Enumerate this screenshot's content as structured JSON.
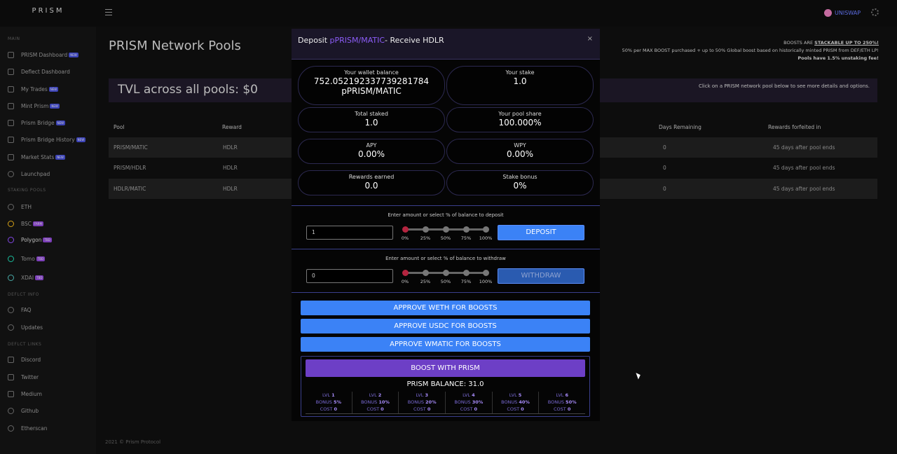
{
  "app": {
    "logo": "PRISM"
  },
  "header": {
    "wallet_label": "UNISWAP",
    "settings_icon": "gear-icon"
  },
  "sidebar": {
    "sections": {
      "main": "MAIN",
      "staking": "STAKING POOLS",
      "info": "DEFLCT INFO",
      "links": "DEFLCT LINKS"
    },
    "main_items": [
      {
        "label": "PRISM Dashboard",
        "badge": "NEW"
      },
      {
        "label": "Deflect Dashboard",
        "badge": ""
      },
      {
        "label": "My Trades",
        "badge": "NEW"
      },
      {
        "label": "Mint Prism",
        "badge": "NEW"
      },
      {
        "label": "Prism Bridge",
        "badge": "NEW"
      },
      {
        "label": "Prism Bridge History",
        "badge": "NEW"
      },
      {
        "label": "Market Stats",
        "badge": "NEW"
      },
      {
        "label": "Launchpad",
        "badge": ""
      }
    ],
    "pool_items": [
      {
        "label": "ETH",
        "badge": ""
      },
      {
        "label": "BSC",
        "badge": "FARM"
      },
      {
        "label": "Polygon",
        "badge": "TBD"
      },
      {
        "label": "Tomo",
        "badge": "TBD"
      },
      {
        "label": "XDAI",
        "badge": "TBD"
      }
    ],
    "info_items": [
      {
        "label": "FAQ"
      },
      {
        "label": "Updates"
      }
    ],
    "link_items": [
      {
        "label": "Discord"
      },
      {
        "label": "Twitter"
      },
      {
        "label": "Medium"
      },
      {
        "label": "Github"
      },
      {
        "label": "Etherscan"
      }
    ]
  },
  "page": {
    "title": "PRISM Network Pools",
    "boost_line1_a": "BOOSTS ARE ",
    "boost_line1_b": "STACKABLE UP TO 250%!",
    "boost_line2": "50% per MAX BOOST purchased + up to 50% Global boost based on historically minted PRISM from DEF/ETH LP!",
    "boost_line3": "Pools have 1.5% unstaking fee!",
    "tvl": "TVL across all pools: $0",
    "tvl_hint": "Click on a PRISM network pool below to see more details and options.",
    "table": {
      "headers": [
        "Pool",
        "Reward",
        "Days Remaining",
        "Rewards forfeited in"
      ],
      "rows": [
        {
          "pool": "PRISM/MATIC",
          "reward": "HDLR",
          "days": "0",
          "forfeit": "45 days after pool ends"
        },
        {
          "pool": "PRISM/HDLR",
          "reward": "HDLR",
          "days": "0",
          "forfeit": "45 days after pool ends"
        },
        {
          "pool": "HDLR/MATIC",
          "reward": "HDLR",
          "days": "0",
          "forfeit": "45 days after pool ends"
        }
      ]
    },
    "footer": "2021 © Prism Protocol"
  },
  "modal": {
    "title_a": "Deposit ",
    "title_b": "pPRISM/MATIC",
    "title_c": "- Receive HDLR",
    "close": "×",
    "wallet_label": "Your wallet balance",
    "wallet_value_1": "752.052192337739281784",
    "wallet_value_2": "pPRISM/MATIC",
    "stake_label": "Your stake",
    "stake_value": "1.0",
    "total_label": "Total staked",
    "total_value": "1.0",
    "share_label": "Your pool share",
    "share_value": "100.000%",
    "apy_label": "APY",
    "apy_value": "0.00%",
    "wpy_label": "WPY",
    "wpy_value": "0.00%",
    "earned_label": "Rewards earned",
    "earned_value": "0.0",
    "bonus_label": "Stake bonus",
    "bonus_value": "0%",
    "deposit_hint": "Enter amount or select % of balance to deposit",
    "deposit_value": "1",
    "deposit_btn": "DEPOSIT",
    "withdraw_hint": "Enter amount or select % of balance to withdraw",
    "withdraw_value": "0",
    "withdraw_btn": "WITHDRAW",
    "pct": [
      "0%",
      "25%",
      "50%",
      "75%",
      "100%"
    ],
    "approve_weth": "APPROVE WETH FOR BOOSTS",
    "approve_usdc": "APPROVE USDC FOR BOOSTS",
    "approve_wmatic": "APPROVE WMATIC FOR BOOSTS",
    "boost_btn": "BOOST WITH PRISM",
    "prism_balance": "PRISM BALANCE: 31.0",
    "levels": [
      {
        "lvl": "1",
        "bonus": "5%",
        "cost": "0"
      },
      {
        "lvl": "2",
        "bonus": "10%",
        "cost": "0"
      },
      {
        "lvl": "3",
        "bonus": "20%",
        "cost": "0"
      },
      {
        "lvl": "4",
        "bonus": "30%",
        "cost": "0"
      },
      {
        "lvl": "5",
        "bonus": "40%",
        "cost": "0"
      },
      {
        "lvl": "6",
        "bonus": "50%",
        "cost": "0"
      }
    ],
    "lvl_prefix": "LVL ",
    "bonus_prefix": "BONUS ",
    "cost_prefix": "COST "
  }
}
